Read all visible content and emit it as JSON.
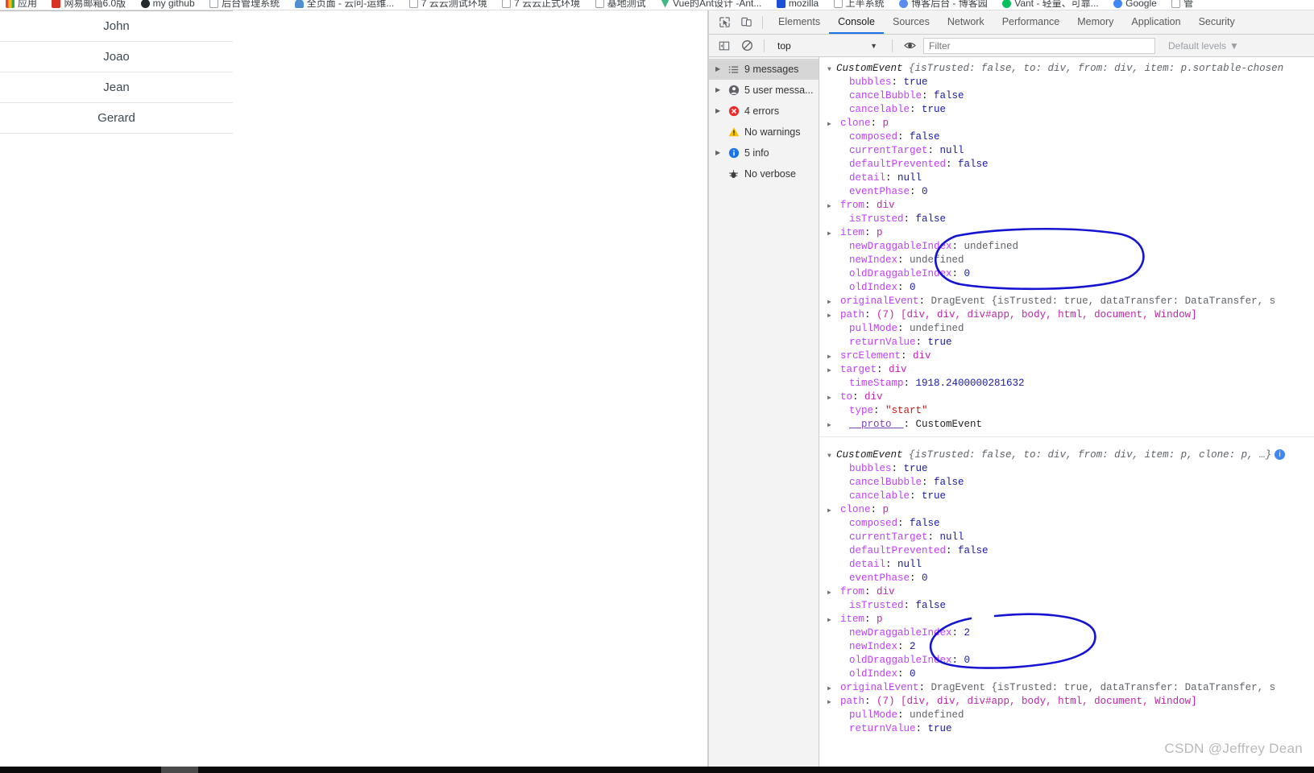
{
  "bookmarks": [
    {
      "label": "应用",
      "icon": "apps-grid-icon"
    },
    {
      "label": "网易邮箱6.0版",
      "icon": "mail-icon"
    },
    {
      "label": "my github",
      "icon": "github-icon"
    },
    {
      "label": "后台管理系统",
      "icon": "bookmark-square-icon"
    },
    {
      "label": "全页面 - 云问-运维...",
      "icon": "cloud-icon"
    },
    {
      "label": "7 云云测试环境",
      "icon": "bookmark-square-icon"
    },
    {
      "label": "7 云云正式环境",
      "icon": "bookmark-square-icon"
    },
    {
      "label": "基地测试",
      "icon": "bookmark-square-icon"
    },
    {
      "label": "Vue的Ant设计 -Ant...",
      "icon": "vue-icon"
    },
    {
      "label": "mozilla",
      "icon": "mozilla-icon"
    },
    {
      "label": "上半系统",
      "icon": "bookmark-square-icon"
    },
    {
      "label": "博客后台 - 博客园",
      "icon": "blog-icon"
    },
    {
      "label": "Vant - 轻量、可靠...",
      "icon": "vant-icon"
    },
    {
      "label": "Google",
      "icon": "google-icon"
    },
    {
      "label": "管",
      "icon": "bookmark-square-icon"
    }
  ],
  "page": {
    "list_name": "sortable-name-list",
    "items": [
      "John",
      "Joao",
      "Jean",
      "Gerard"
    ]
  },
  "devtools": {
    "toolbar": {
      "inspect_icon": "inspect-cursor-icon",
      "device_icon": "device-toolbar-icon"
    },
    "tabs": [
      {
        "label": "Elements",
        "active": false
      },
      {
        "label": "Console",
        "active": true
      },
      {
        "label": "Sources",
        "active": false
      },
      {
        "label": "Network",
        "active": false
      },
      {
        "label": "Performance",
        "active": false
      },
      {
        "label": "Memory",
        "active": false
      },
      {
        "label": "Application",
        "active": false
      },
      {
        "label": "Security",
        "active": false
      }
    ],
    "filterbar": {
      "sidebar_toggle_icon": "show-console-sidebar-icon",
      "clear_icon": "clear-console-icon",
      "context": "top",
      "context_caret": "▼",
      "eye_icon": "live-expression-icon",
      "filter_value": "",
      "filter_placeholder": "Filter",
      "levels_label": "Default levels",
      "levels_caret": "▼"
    },
    "sidebar": [
      {
        "label": "9 messages",
        "icon": "list-icon",
        "expandable": true,
        "selected": true
      },
      {
        "label": "5 user messa...",
        "icon": "user-icon",
        "expandable": true,
        "selected": false
      },
      {
        "label": "4 errors",
        "icon": "error-icon",
        "expandable": true,
        "selected": false
      },
      {
        "label": "No warnings",
        "icon": "warning-icon",
        "expandable": false,
        "selected": false
      },
      {
        "label": "5 info",
        "icon": "info-icon",
        "expandable": true,
        "selected": false
      },
      {
        "label": "No verbose",
        "icon": "verbose-bug-icon",
        "expandable": false,
        "selected": false
      }
    ],
    "console_logs": [
      {
        "header": {
          "class": "CustomEvent",
          "preview": "{isTrusted: false, to: div, from: div, item: p.sortable-chosen",
          "truncated": true
        },
        "properties": [
          {
            "key": "bubbles",
            "value": "true",
            "type": "bool",
            "expandable": false
          },
          {
            "key": "cancelBubble",
            "value": "false",
            "type": "bool",
            "expandable": false
          },
          {
            "key": "cancelable",
            "value": "true",
            "type": "bool",
            "expandable": false
          },
          {
            "key": "clone",
            "value": "p",
            "type": "node",
            "expandable": true
          },
          {
            "key": "composed",
            "value": "false",
            "type": "bool",
            "expandable": false
          },
          {
            "key": "currentTarget",
            "value": "null",
            "type": "bool",
            "expandable": false
          },
          {
            "key": "defaultPrevented",
            "value": "false",
            "type": "bool",
            "expandable": false
          },
          {
            "key": "detail",
            "value": "null",
            "type": "bool",
            "expandable": false
          },
          {
            "key": "eventPhase",
            "value": "0",
            "type": "num",
            "expandable": false
          },
          {
            "key": "from",
            "value": "div",
            "type": "node",
            "expandable": true
          },
          {
            "key": "isTrusted",
            "value": "false",
            "type": "bool",
            "expandable": false
          },
          {
            "key": "item",
            "value": "p",
            "type": "node",
            "expandable": true
          },
          {
            "key": "newDraggableIndex",
            "value": "undefined",
            "type": "undef",
            "expandable": false
          },
          {
            "key": "newIndex",
            "value": "undefined",
            "type": "undef",
            "expandable": false
          },
          {
            "key": "oldDraggableIndex",
            "value": "0",
            "type": "num",
            "expandable": false
          },
          {
            "key": "oldIndex",
            "value": "0",
            "type": "num",
            "expandable": false
          },
          {
            "key": "originalEvent",
            "value": "DragEvent {isTrusted: true, dataTransfer: DataTransfer, s",
            "type": "objpreview",
            "expandable": true
          },
          {
            "key": "path",
            "value": "(7) [div, div, div#app, body, html, document, Window]",
            "type": "array",
            "expandable": true
          },
          {
            "key": "pullMode",
            "value": "undefined",
            "type": "undef",
            "expandable": false
          },
          {
            "key": "returnValue",
            "value": "true",
            "type": "bool",
            "expandable": false
          },
          {
            "key": "srcElement",
            "value": "div",
            "type": "node",
            "expandable": true
          },
          {
            "key": "target",
            "value": "div",
            "type": "node",
            "expandable": true
          },
          {
            "key": "timeStamp",
            "value": "1918.2400000281632",
            "type": "num",
            "expandable": false
          },
          {
            "key": "to",
            "value": "div",
            "type": "node",
            "expandable": true
          },
          {
            "key": "type",
            "value": "\"start\"",
            "type": "str",
            "expandable": false
          },
          {
            "key": "__proto__",
            "value": "CustomEvent",
            "type": "proto",
            "expandable": true
          }
        ]
      },
      {
        "header": {
          "class": "CustomEvent",
          "preview": "{isTrusted: false, to: div, from: div, item: p, clone: p, …}",
          "badge": "i",
          "truncated": false
        },
        "properties": [
          {
            "key": "bubbles",
            "value": "true",
            "type": "bool",
            "expandable": false
          },
          {
            "key": "cancelBubble",
            "value": "false",
            "type": "bool",
            "expandable": false
          },
          {
            "key": "cancelable",
            "value": "true",
            "type": "bool",
            "expandable": false
          },
          {
            "key": "clone",
            "value": "p",
            "type": "node",
            "expandable": true
          },
          {
            "key": "composed",
            "value": "false",
            "type": "bool",
            "expandable": false
          },
          {
            "key": "currentTarget",
            "value": "null",
            "type": "bool",
            "expandable": false
          },
          {
            "key": "defaultPrevented",
            "value": "false",
            "type": "bool",
            "expandable": false
          },
          {
            "key": "detail",
            "value": "null",
            "type": "bool",
            "expandable": false
          },
          {
            "key": "eventPhase",
            "value": "0",
            "type": "num",
            "expandable": false
          },
          {
            "key": "from",
            "value": "div",
            "type": "node",
            "expandable": true
          },
          {
            "key": "isTrusted",
            "value": "false",
            "type": "bool",
            "expandable": false
          },
          {
            "key": "item",
            "value": "p",
            "type": "node",
            "expandable": true
          },
          {
            "key": "newDraggableIndex",
            "value": "2",
            "type": "num",
            "expandable": false
          },
          {
            "key": "newIndex",
            "value": "2",
            "type": "num",
            "expandable": false
          },
          {
            "key": "oldDraggableIndex",
            "value": "0",
            "type": "num",
            "expandable": false
          },
          {
            "key": "oldIndex",
            "value": "0",
            "type": "num",
            "expandable": false
          },
          {
            "key": "originalEvent",
            "value": "DragEvent {isTrusted: true, dataTransfer: DataTransfer, s",
            "type": "objpreview",
            "expandable": true
          },
          {
            "key": "path",
            "value": "(7) [div, div, div#app, body, html, document, Window]",
            "type": "array",
            "expandable": true
          },
          {
            "key": "pullMode",
            "value": "undefined",
            "type": "undef",
            "expandable": false
          },
          {
            "key": "returnValue",
            "value": "true",
            "type": "bool",
            "expandable": false
          }
        ]
      }
    ],
    "annotations": [
      {
        "name": "highlight-ellipse-first",
        "color": "#1414d2",
        "label": "circled newDraggableIndex/newIndex/oldDraggableIndex/oldIndex (undefined, undefined, 0, 0)"
      },
      {
        "name": "highlight-ellipse-second",
        "color": "#1414d2",
        "label": "circled newDraggableIndex/newIndex/oldDraggableIndex/oldIndex (2, 2, 0, 0)"
      }
    ]
  },
  "watermark": "CSDN @Jeffrey Dean"
}
